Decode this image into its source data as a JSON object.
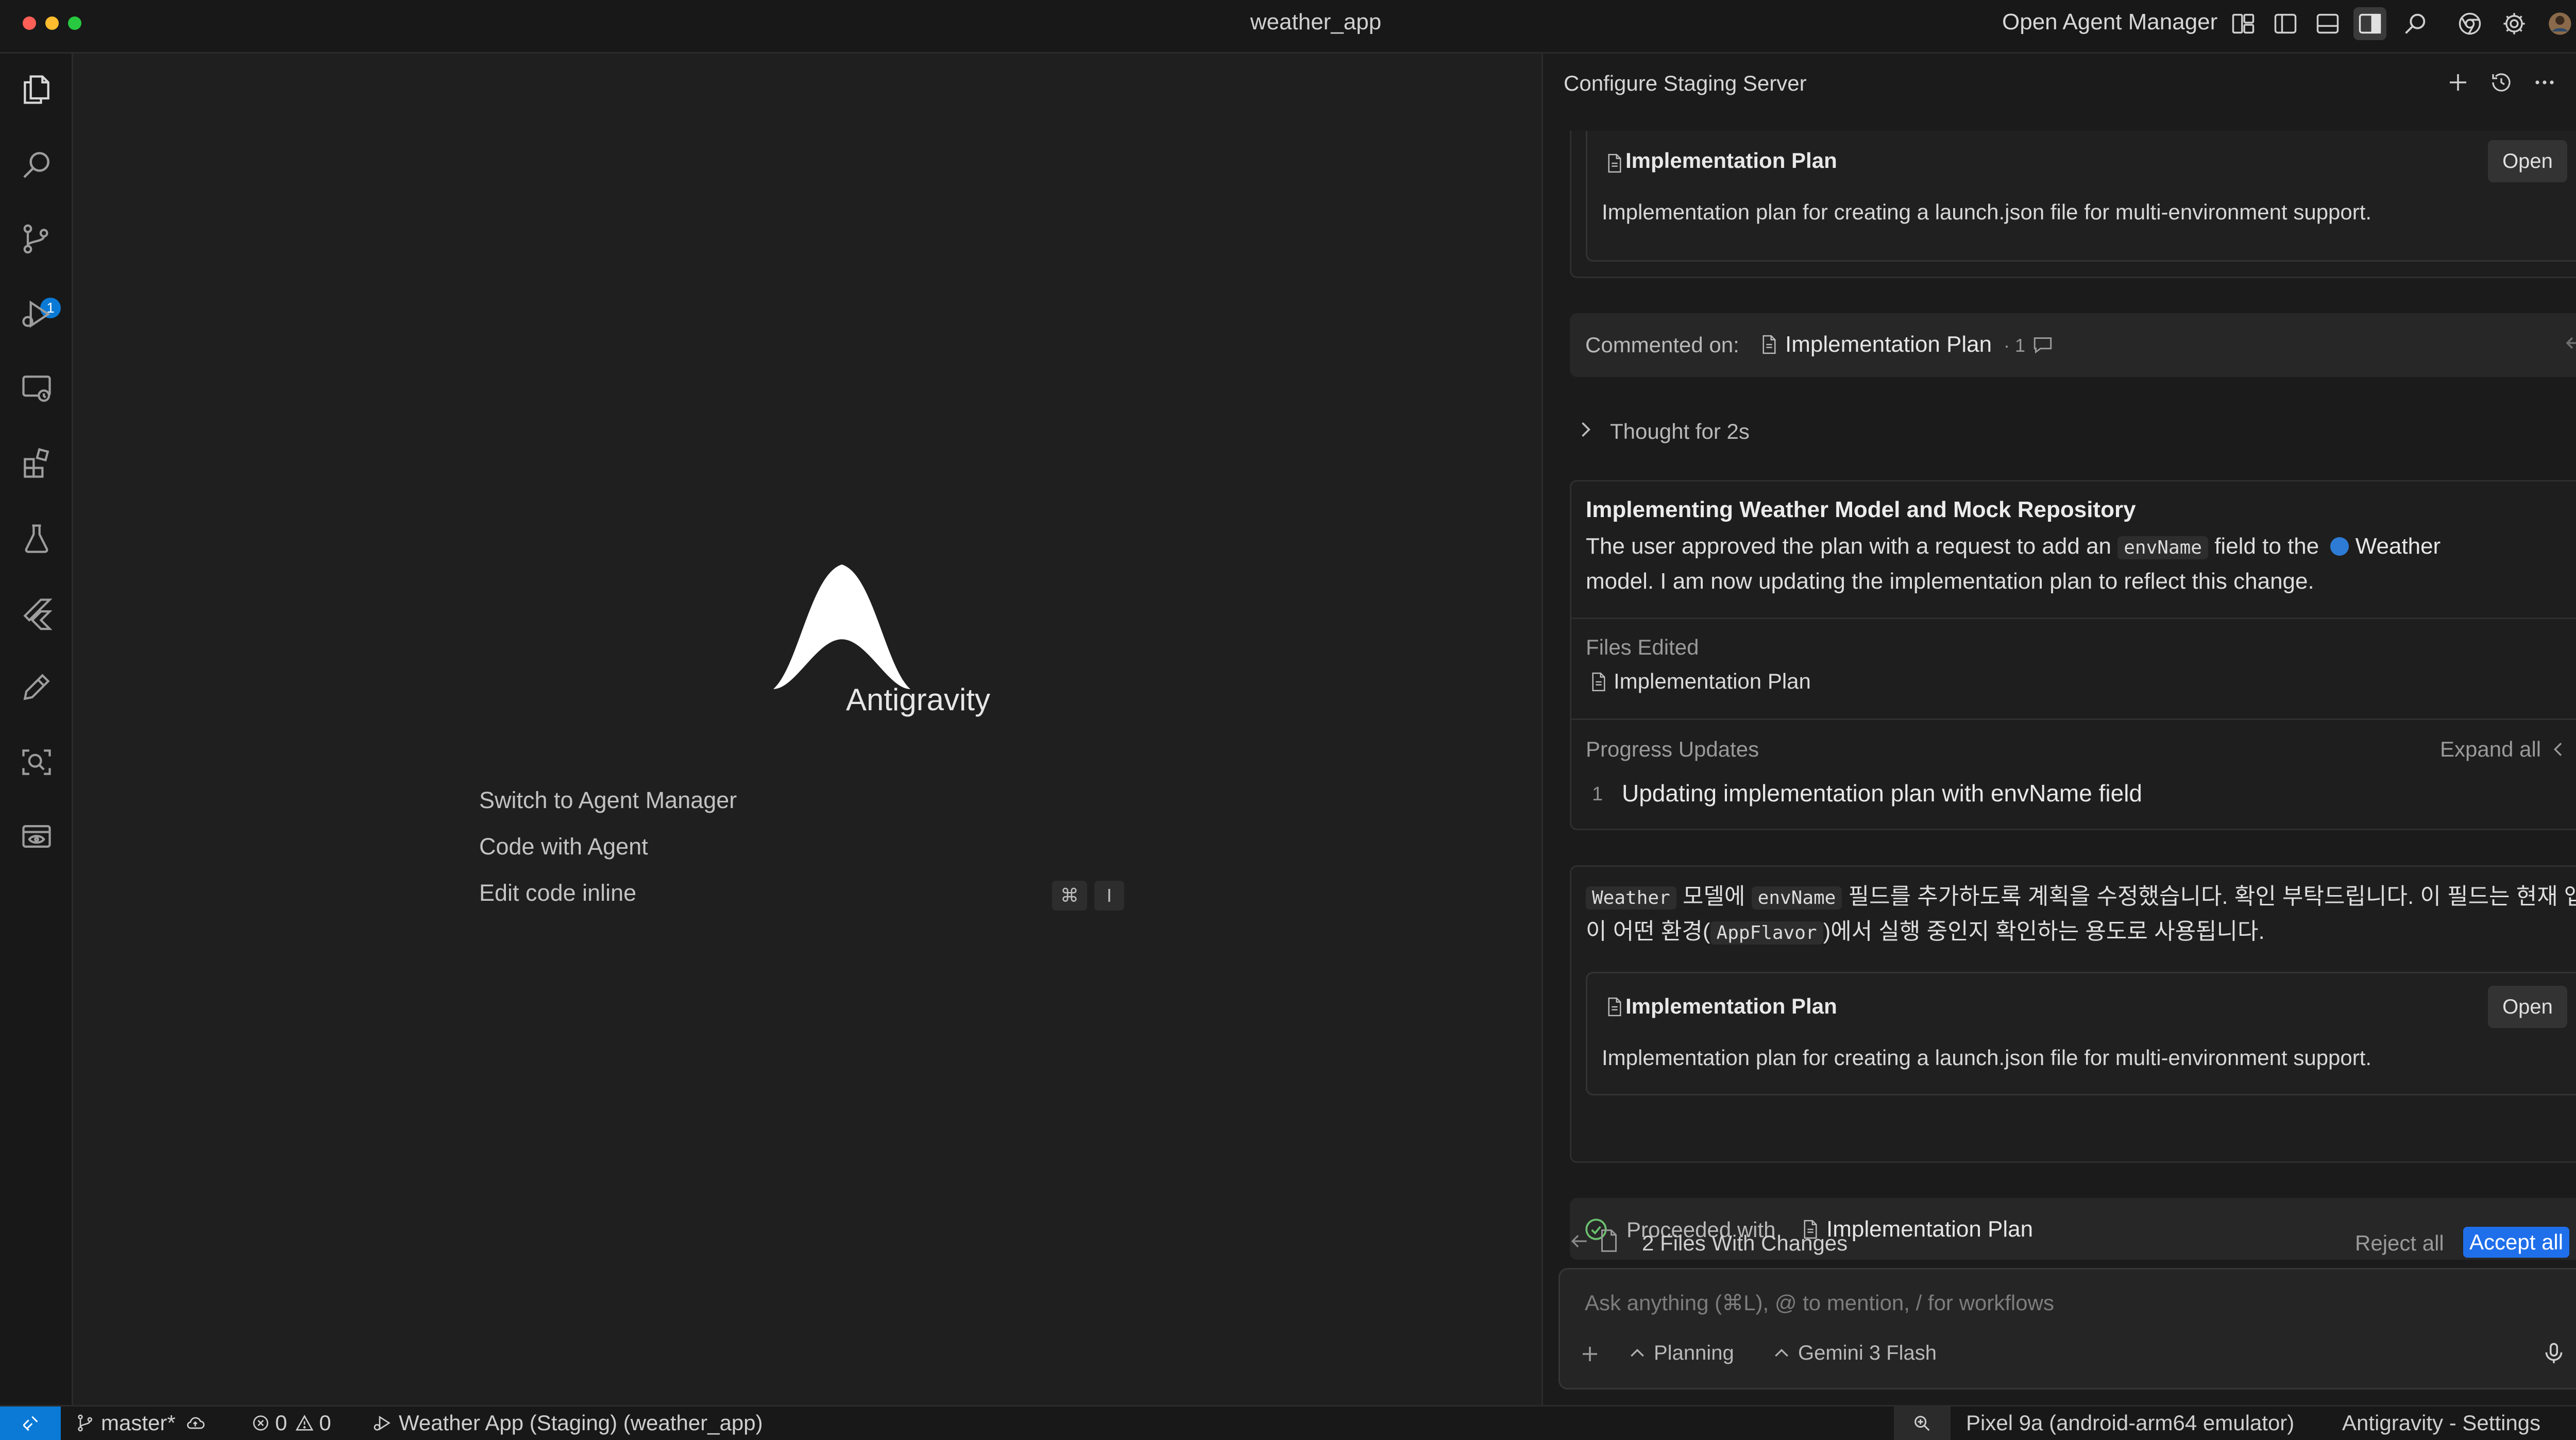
{
  "window": {
    "title": "weather_app"
  },
  "titlebar": {
    "open_agent_manager": "Open Agent Manager",
    "icons": [
      "layout-icon",
      "toggle-primary-sidebar-icon",
      "toggle-panel-icon",
      "toggle-secondary-sidebar-icon",
      "search-icon",
      "chrome-icon",
      "gear-icon",
      "account-avatar"
    ]
  },
  "activitybar": {
    "items": [
      "explorer-icon",
      "search-icon",
      "source-control-icon",
      "run-debug-icon",
      "remote-explorer-icon",
      "extensions-icon",
      "testing-icon",
      "flutter-icon",
      "edit-pen-icon",
      "inspect-icon",
      "preview-icon"
    ],
    "source_control_badge": "1"
  },
  "welcome": {
    "product_name": "Antigravity",
    "items": [
      {
        "label": "Switch to Agent Manager"
      },
      {
        "label": "Code with Agent"
      },
      {
        "label": "Edit code inline",
        "keys": [
          "⌘",
          "I"
        ]
      }
    ]
  },
  "panel": {
    "title": "Configure Staging Server",
    "artifact1": {
      "title": "Implementation Plan",
      "open_label": "Open",
      "description": "Implementation plan for creating a launch.json file for multi-environment support."
    },
    "comment": {
      "prefix": "Commented on:",
      "target": "Implementation Plan",
      "count": "· 1"
    },
    "thought": "Thought for 2s",
    "task": {
      "title": "Implementing Weather Model and Mock Repository",
      "line1_a": "The user approved the plan with a request to add an",
      "line1_code": "envName",
      "line1_b": "field to the",
      "line1_link": "Weather",
      "line2": "model. I am now updating the implementation plan to reflect this change.",
      "files_edited_label": "Files Edited",
      "file": "Implementation Plan",
      "progress_label": "Progress Updates",
      "expand_all": "Expand all",
      "progress_index": "1",
      "progress_text": "Updating implementation plan with envName field"
    },
    "message": {
      "code1": "Weather",
      "t1": "모델에",
      "code2": "envName",
      "t2": "필드를 추가하도록 계획을 수정했습니다. 확인 부탁드립니다. 이 필드는 현재 앱",
      "t3": "이 어떤 환경(",
      "code3": "AppFlavor",
      "t4": ")에서 실행 중인지 확인하는 용도로 사용됩니다."
    },
    "artifact2": {
      "title": "Implementation Plan",
      "open_label": "Open",
      "description": "Implementation plan for creating a launch.json file for multi-environment support."
    },
    "proceeded": {
      "prefix": "Proceeded with",
      "target": "Implementation Plan"
    },
    "changes": {
      "label": "2 Files With Changes",
      "reject_all": "Reject all",
      "accept_all": "Accept all"
    },
    "input": {
      "placeholder": "Ask anything (⌘L), @ to mention, / for workflows",
      "mode": "Planning",
      "model": "Gemini 3 Flash"
    }
  },
  "statusbar": {
    "branch": "master*",
    "errors": "0",
    "warnings": "0",
    "launch_config": "Weather App (Staging) (weather_app)",
    "device": "Pixel 9a (android-arm64 emulator)",
    "settings": "Antigravity - Settings"
  },
  "colors": {
    "accent": "#0a7ad6",
    "accept_button": "#1f6feb",
    "success": "#6cc070",
    "background": "#1f1f1f",
    "panel": "#1b1b1b"
  }
}
